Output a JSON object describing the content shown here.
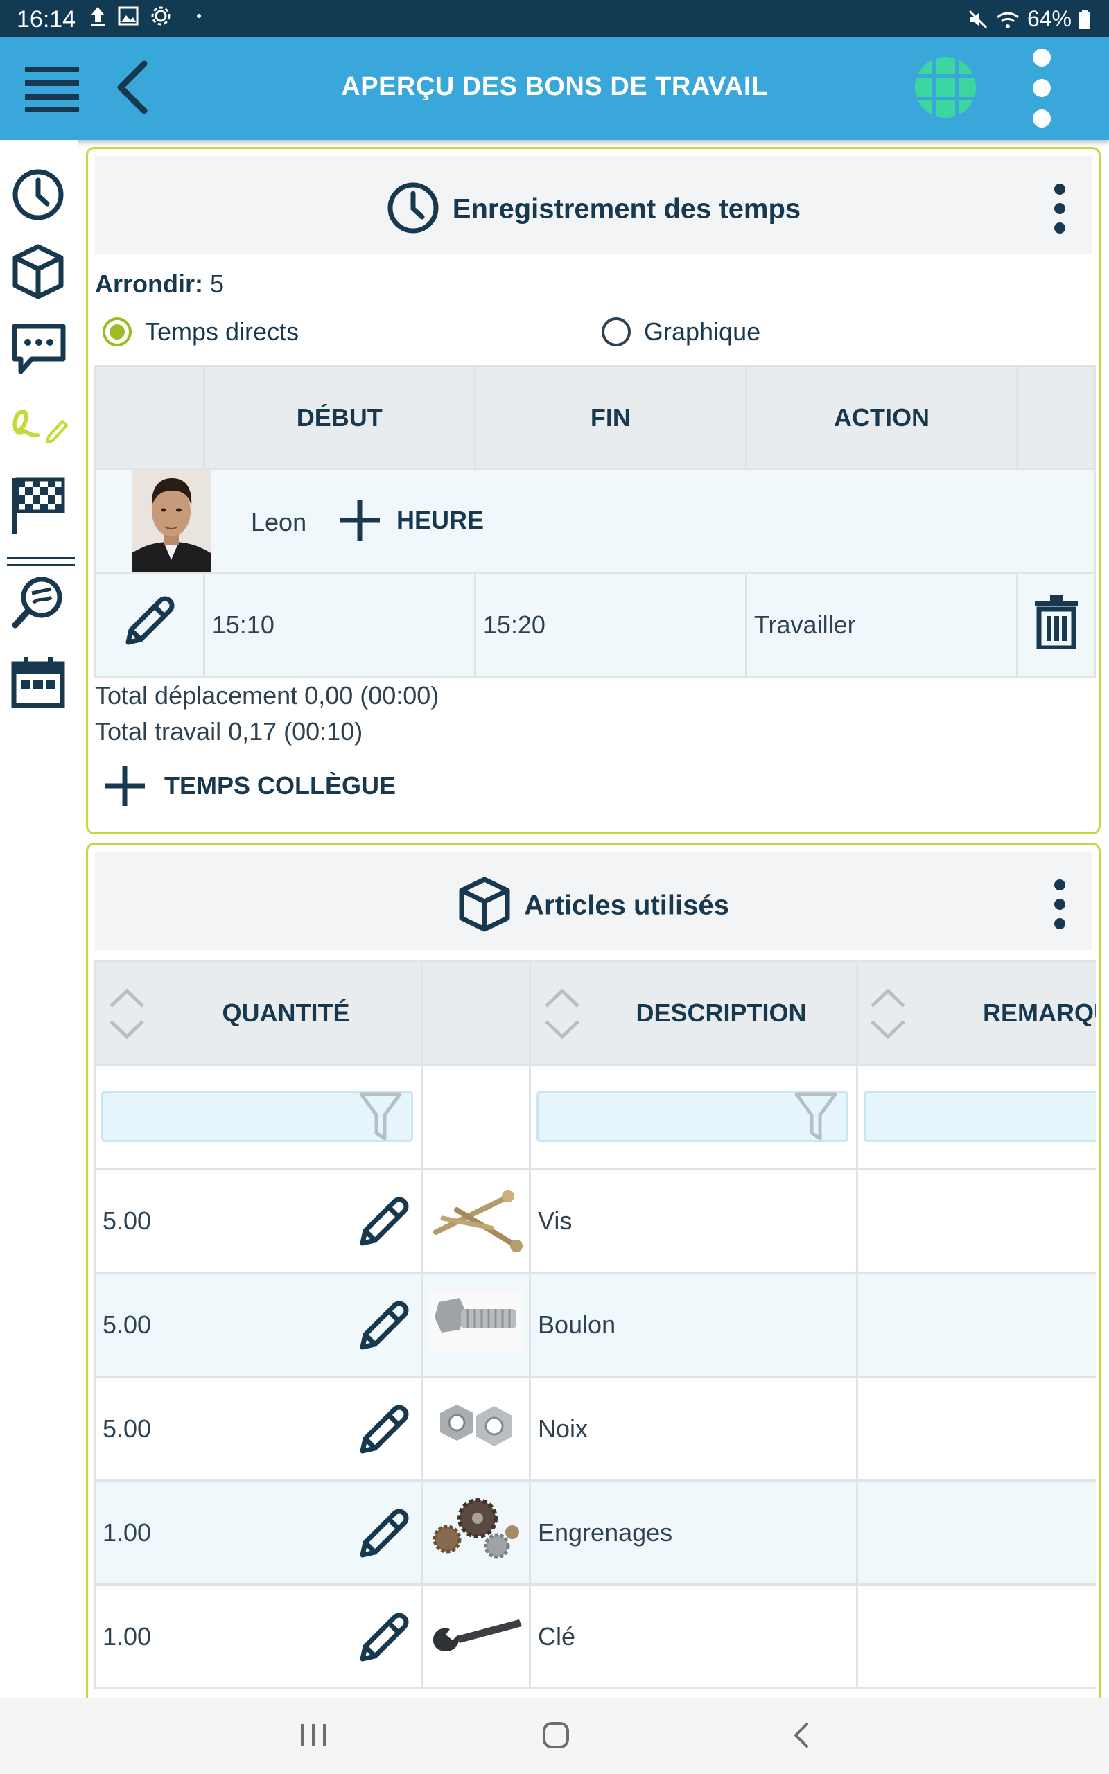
{
  "status_bar": {
    "time": "16:14",
    "battery": "64%"
  },
  "app_bar": {
    "title": "APERÇU DES BONS DE TRAVAIL"
  },
  "sidebar": {
    "items": [
      "clock-icon",
      "box-icon",
      "chat-icon",
      "signature-icon",
      "finish-flag-icon",
      "search-map-icon",
      "calendar-icon"
    ]
  },
  "time_section": {
    "title": "Enregistrement des temps",
    "arrondir_label": "Arrondir:",
    "arrondir_value": "5",
    "radio_direct": "Temps directs",
    "radio_graph": "Graphique",
    "columns": [
      "DÉBUT",
      "FIN",
      "ACTION"
    ],
    "employee_name": "Leon",
    "add_hour": "HEURE",
    "entry": {
      "start": "15:10",
      "end": "15:20",
      "action": "Travailler"
    },
    "total_travel": "Total déplacement 0,00 (00:00)",
    "total_work": "Total travail 0,17 (00:10)",
    "add_colleague": "TEMPS COLLÈGUE"
  },
  "articles_section": {
    "title": "Articles utilisés",
    "columns": [
      "QUANTITÉ",
      "DESCRIPTION",
      "REMARQU"
    ],
    "rows": [
      {
        "qty": "5.00",
        "desc": "Vis",
        "image": "screws-image"
      },
      {
        "qty": "5.00",
        "desc": "Boulon",
        "image": "bolt-image"
      },
      {
        "qty": "5.00",
        "desc": "Noix",
        "image": "nuts-image"
      },
      {
        "qty": "1.00",
        "desc": "Engrenages",
        "image": "gears-image"
      },
      {
        "qty": "1.00",
        "desc": "Clé",
        "image": "wrench-image"
      }
    ]
  },
  "colors": {
    "header": "#3aa7db",
    "status": "#123a52",
    "navy": "#17384e",
    "accent": "#c5d93a",
    "grid_logo": "#3dd6a0"
  }
}
